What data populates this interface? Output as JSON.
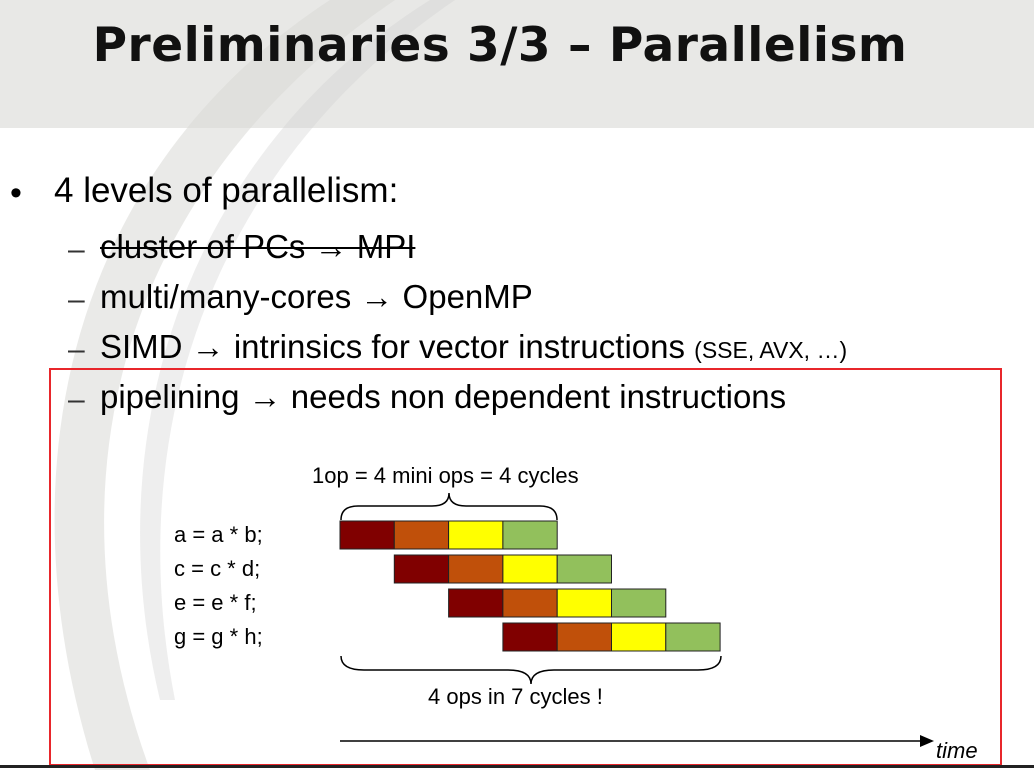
{
  "slide": {
    "title": "Preliminaries 3/3 – Parallelism",
    "bullet_marker": "•",
    "bullet": "4 levels of parallelism:",
    "dash": "–",
    "sub_items": [
      {
        "text": "cluster of PCs → MPI",
        "struck": true
      },
      {
        "text": "multi/many-cores → OpenMP",
        "struck": false
      },
      {
        "text": "SIMD → intrinsics for vector instructions",
        "note": "(SSE, AVX, …)",
        "struck": false
      },
      {
        "text": "pipelining → needs non dependent instructions",
        "struck": false
      }
    ]
  },
  "diagram": {
    "top_label": "1op = 4 mini ops = 4 cycles",
    "bottom_label": "4 ops in 7 cycles !",
    "axis_label": "time",
    "instructions": [
      "a = a * b;",
      "c = c * d;",
      "e = e * f;",
      "g = g * h;"
    ],
    "stage_colors": [
      "#800000",
      "#c0500a",
      "#ffff00",
      "#92c05c"
    ],
    "stages_per_op": 4,
    "total_cycles": 7,
    "box_color": "#e8262b"
  }
}
